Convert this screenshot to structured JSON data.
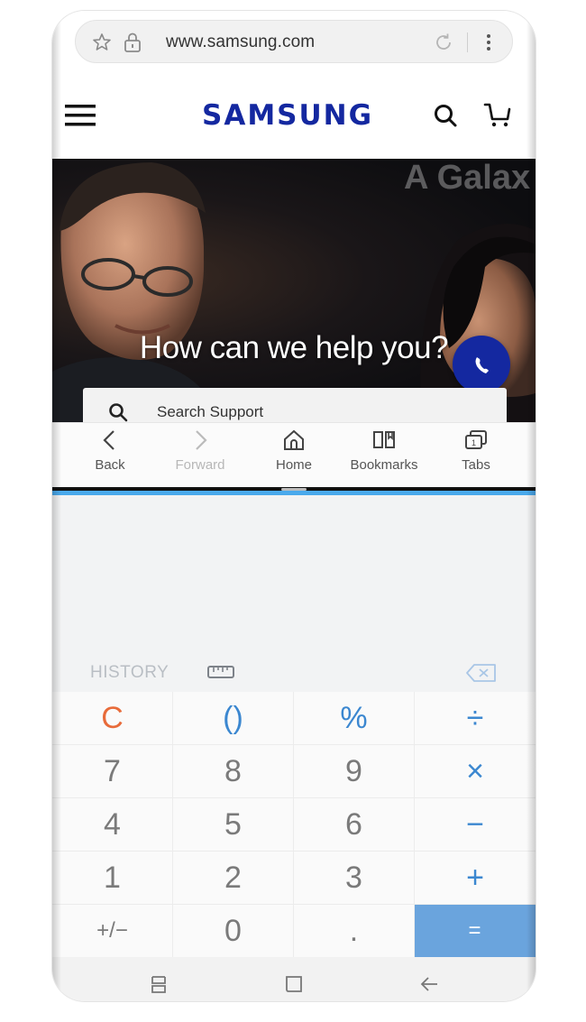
{
  "browser": {
    "url": "www.samsung.com"
  },
  "site": {
    "brand": "SAMSUNG",
    "hero_bg_text": "A Galax",
    "hero_title": "How can we help you?",
    "search_support_placeholder": "Search Support",
    "brand_color": "#1428a0"
  },
  "browser_nav": {
    "items": [
      {
        "label": "Back",
        "icon": "chevron-left-icon"
      },
      {
        "label": "Forward",
        "icon": "chevron-right-icon"
      },
      {
        "label": "Home",
        "icon": "home-icon"
      },
      {
        "label": "Bookmarks",
        "icon": "bookmarks-icon"
      },
      {
        "label": "Tabs",
        "icon": "tabs-icon"
      }
    ]
  },
  "calculator": {
    "history_label": "HISTORY",
    "accent_color": "#4aa9ec",
    "keys": [
      [
        "C",
        "()",
        "%",
        "÷"
      ],
      [
        "7",
        "8",
        "9",
        "×"
      ],
      [
        "4",
        "5",
        "6",
        "−"
      ],
      [
        "1",
        "2",
        "3",
        "+"
      ],
      [
        "+/−",
        "0",
        ".",
        "="
      ]
    ]
  },
  "system_nav": {
    "items": [
      "recent-apps-icon",
      "home-button-icon",
      "back-arrow-icon"
    ]
  }
}
